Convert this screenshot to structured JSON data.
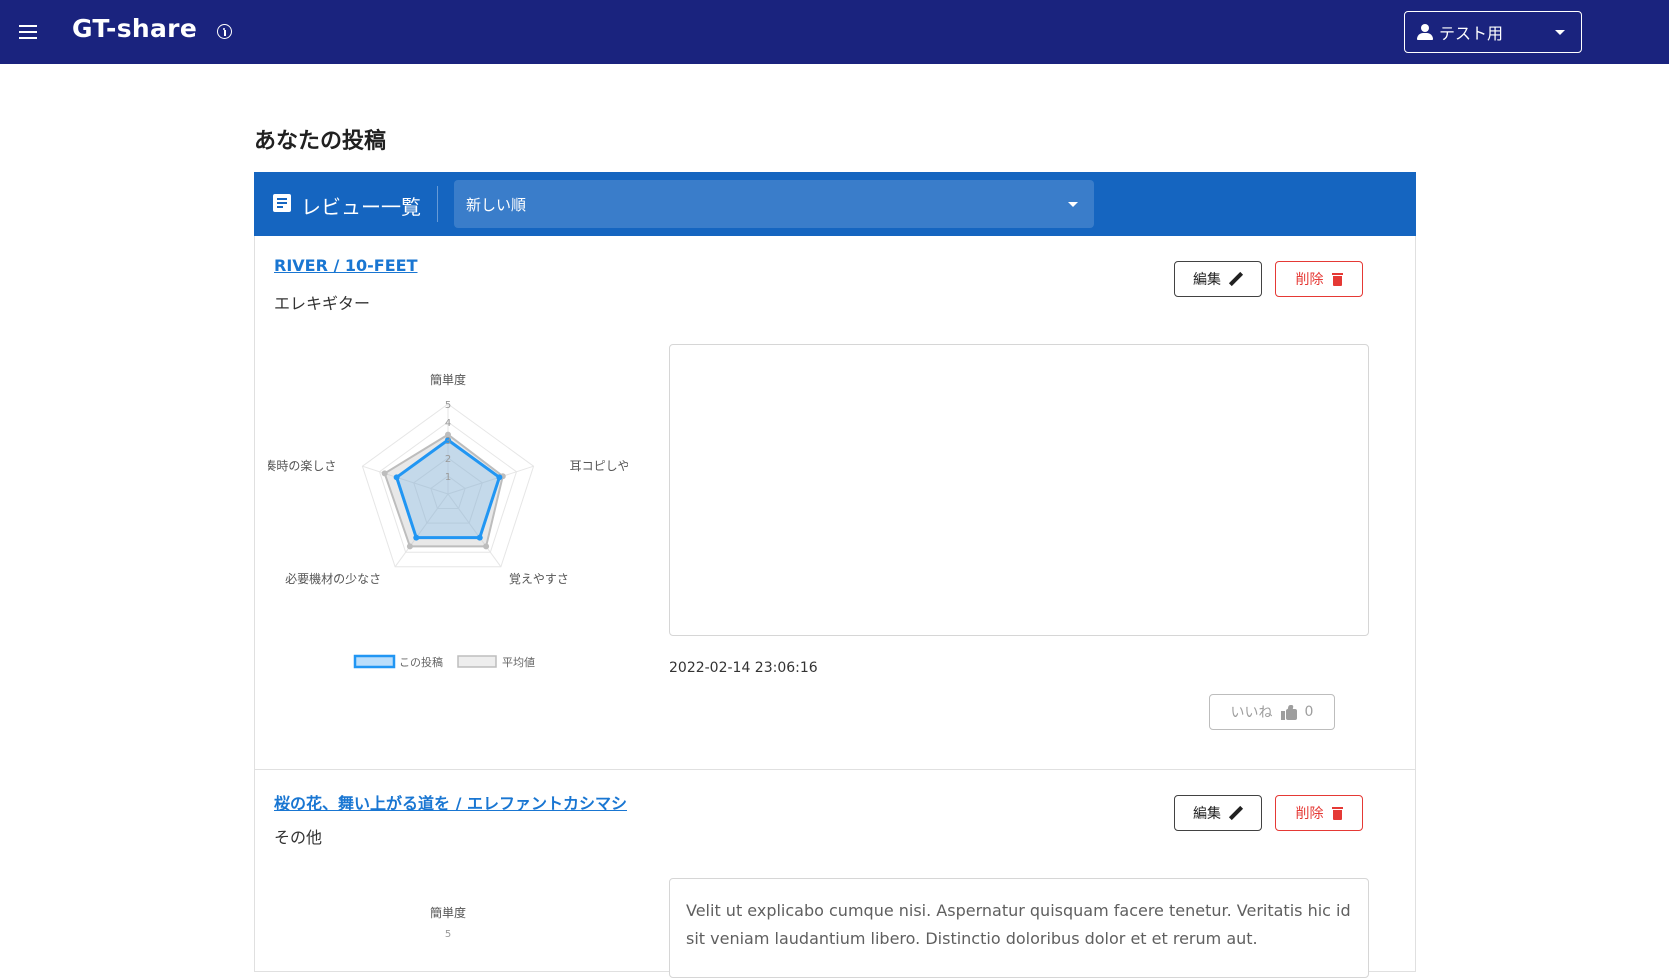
{
  "appbar": {
    "title": "GT-share",
    "menu_icon": "menu-icon",
    "info_icon": "info-icon",
    "user_select_label": "テスト用",
    "color": "#1a237e"
  },
  "page": {
    "title": "あなたの投稿"
  },
  "toolbar": {
    "title": "レビュー一覧",
    "icon": "document-list-icon",
    "sort_value": "新しい順",
    "color": "#1565c0"
  },
  "reviews": [
    {
      "song": "RIVER / 10-FEET",
      "instrument": "エレキギター",
      "edit_label": "編集",
      "delete_label": "削除",
      "comment": "",
      "timestamp": "2022-02-14 23:06:16",
      "like_label": "いいね",
      "like_count": "0",
      "radar": {
        "axes": [
          "簡単度",
          "耳コピしやすさ",
          "覚えやすさ",
          "必要機材の少なさ",
          "演奏時の楽しさ"
        ],
        "ticks": [
          "1",
          "2",
          "3",
          "4",
          "5"
        ],
        "max": 5,
        "series": [
          {
            "name": "この投稿",
            "values": [
              3,
              3,
              3,
              3,
              3
            ],
            "color": "#2196f3"
          },
          {
            "name": "平均値",
            "values": [
              3.3,
              3.2,
              3.6,
              3.6,
              3.7
            ],
            "color": "#bdbdbd"
          }
        ]
      }
    },
    {
      "song": "桜の花、舞い上がる道を / エレファントカシマシ",
      "instrument": "その他",
      "edit_label": "編集",
      "delete_label": "削除",
      "comment": "Velit ut explicabo cumque nisi. Aspernatur quisquam facere tenetur. Veritatis hic id sit veniam laudantium libero. Distinctio doloribus dolor et et rerum aut.",
      "radar": {
        "axes": [
          "簡単度"
        ],
        "ticks": [
          "5"
        ]
      }
    }
  ]
}
